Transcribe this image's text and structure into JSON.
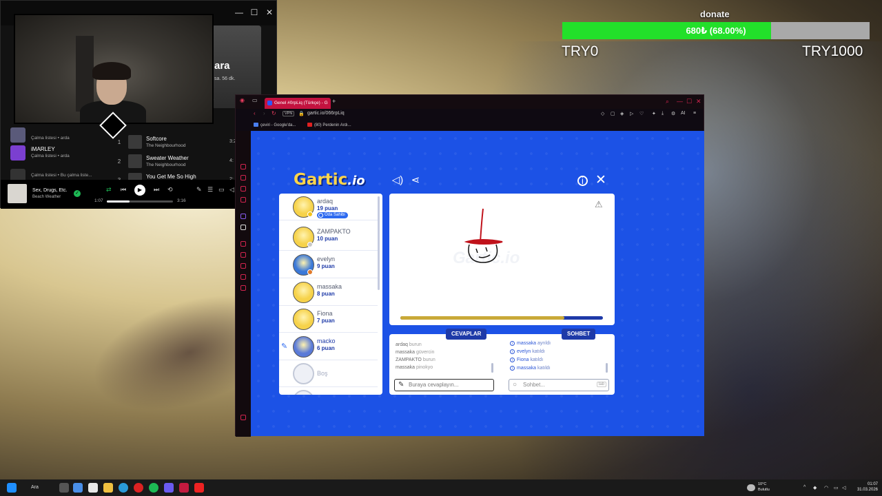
{
  "donate": {
    "title": "donate",
    "progress_label": "680₺ (68.00%)",
    "progress_fraction": 0.68,
    "min_label": "TRY0",
    "max_label": "TRY1000",
    "fill_color": "#22e02a"
  },
  "spotify": {
    "banner_title": "ara",
    "banner_sub": "sa. 56 dk.",
    "banner_badge": "le",
    "sidebar": [
      {
        "title": "",
        "sub": "Çalma listesi • arda",
        "thumb_color": "#5a5a7a"
      },
      {
        "title": "iMARLEY",
        "sub": "Çalma listesi • arda",
        "thumb_color": "#7b3fd0"
      },
      {
        "title": "",
        "sub": "Çalma listesi • Bu çalma liste...",
        "thumb_color": "#333333"
      }
    ],
    "tracks": [
      {
        "num": "1",
        "title": "Softcore",
        "artist": "The Neighbourhood",
        "duration": "3:2"
      },
      {
        "num": "2",
        "title": "Sweater Weather",
        "artist": "The Neighbourhood",
        "duration": "4:"
      },
      {
        "num": "3",
        "title": "You Get Me So High",
        "artist": "",
        "duration": "2:"
      }
    ],
    "player": {
      "title": "Sex, Drugs, Etc.",
      "artist": "Beach Weather",
      "elapsed": "1:07",
      "total": "3:16",
      "progress_fraction": 0.34
    }
  },
  "browser": {
    "tab_title": "Genel #0rpLiq (Türkçe) - G",
    "vpn_label": "VPN",
    "url": "gartic.io/066rpLiq",
    "ai_label": "AI",
    "bookmarks": [
      {
        "label": "çeviri - Google'da...",
        "color": "#4a7ff0"
      },
      {
        "label": "(80) Perdenin Ardı...",
        "color": "#e02020"
      }
    ]
  },
  "gartic": {
    "logo_main": "Gartic",
    "logo_suffix": ".io",
    "players": [
      {
        "name": "ardaq",
        "points": "19 puan",
        "owner_badge": "Oda Sahibi",
        "avatar_color": "#f6d24a",
        "dot_color": "#f4c31b",
        "drawing": false
      },
      {
        "name": "ZAMPAKTO",
        "points": "10 puan",
        "avatar_color": "#f6d24a",
        "dot_color": "#c8c8c8",
        "drawing": false
      },
      {
        "name": "evelyn",
        "points": "9 puan",
        "avatar_color": "#3a78d8",
        "dot_color": "#e07a2a",
        "drawing": false
      },
      {
        "name": "massaka",
        "points": "8 puan",
        "avatar_color": "#f6d24a",
        "dot_color": "",
        "drawing": false
      },
      {
        "name": "Fiona",
        "points": "7 puan",
        "avatar_color": "#f6d24a",
        "dot_color": "",
        "drawing": false
      },
      {
        "name": "macko",
        "points": "6 puan",
        "avatar_color": "#5a7ad8",
        "dot_color": "",
        "drawing": true
      }
    ],
    "empty_slot": "Boş",
    "timer_fraction": 0.81,
    "answers_tab": "CEVAPLAR",
    "chat_tab": "SOHBET",
    "answers": [
      {
        "who": "ardaq",
        "what": "burun"
      },
      {
        "who": "massaka",
        "what": "güvercin"
      },
      {
        "who": "ZAMPAKTO",
        "what": "burun"
      },
      {
        "who": "massaka",
        "what": "pinokyo"
      }
    ],
    "chat": [
      {
        "who": "massaka",
        "what": "ayrıldı"
      },
      {
        "who": "evelyn",
        "what": "katıldı"
      },
      {
        "who": "Fiona",
        "what": "katıldı"
      },
      {
        "who": "massaka",
        "what": "katıldı"
      }
    ],
    "answer_placeholder": "Buraya cevaplayın...",
    "chat_placeholder": "Sohbet...",
    "chat_key_hint": "tab"
  },
  "taskbar": {
    "search_label": "Ara",
    "weather_temp": "10°C",
    "weather_desc": "Bulutlu",
    "time": "01:07",
    "date": "31.03.2026"
  }
}
